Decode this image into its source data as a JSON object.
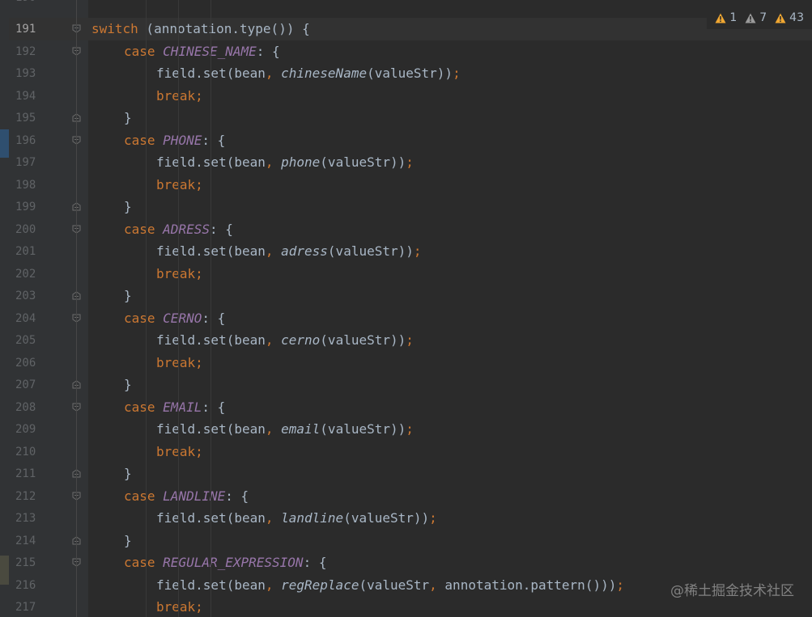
{
  "editor": {
    "partial_top_line": "190",
    "current_line": "191",
    "colors": {
      "background": "#2b2b2b",
      "gutter": "#313335",
      "keyword": "#cc7832",
      "constant": "#9876aa",
      "default_text": "#a9b7c6",
      "line_number": "#606366",
      "warning": "#f0a732"
    },
    "lines": [
      {
        "num": "191",
        "indent": 3,
        "fold": "start",
        "tokens": [
          {
            "t": "switch",
            "c": "kw"
          },
          {
            "t": " (annotation.type()) {",
            "c": "plain"
          }
        ]
      },
      {
        "num": "192",
        "indent": 4,
        "fold": "start",
        "tokens": [
          {
            "t": "case ",
            "c": "kw"
          },
          {
            "t": "CHINESE_NAME",
            "c": "const"
          },
          {
            "t": ": {",
            "c": "plain"
          }
        ]
      },
      {
        "num": "193",
        "indent": 5,
        "fold": "",
        "tokens": [
          {
            "t": "field.set(bean",
            "c": "plain"
          },
          {
            "t": ", ",
            "c": "punct"
          },
          {
            "t": "chineseName",
            "c": "method"
          },
          {
            "t": "(valueStr))",
            "c": "plain"
          },
          {
            "t": ";",
            "c": "punct"
          }
        ]
      },
      {
        "num": "194",
        "indent": 5,
        "fold": "",
        "tokens": [
          {
            "t": "break;",
            "c": "kw"
          }
        ]
      },
      {
        "num": "195",
        "indent": 4,
        "fold": "end",
        "tokens": [
          {
            "t": "}",
            "c": "plain"
          }
        ]
      },
      {
        "num": "196",
        "indent": 4,
        "fold": "start",
        "tokens": [
          {
            "t": "case ",
            "c": "kw"
          },
          {
            "t": "PHONE",
            "c": "const"
          },
          {
            "t": ": {",
            "c": "plain"
          }
        ]
      },
      {
        "num": "197",
        "indent": 5,
        "fold": "",
        "tokens": [
          {
            "t": "field.set(bean",
            "c": "plain"
          },
          {
            "t": ", ",
            "c": "punct"
          },
          {
            "t": "phone",
            "c": "method"
          },
          {
            "t": "(valueStr))",
            "c": "plain"
          },
          {
            "t": ";",
            "c": "punct"
          }
        ]
      },
      {
        "num": "198",
        "indent": 5,
        "fold": "",
        "tokens": [
          {
            "t": "break;",
            "c": "kw"
          }
        ]
      },
      {
        "num": "199",
        "indent": 4,
        "fold": "end",
        "tokens": [
          {
            "t": "}",
            "c": "plain"
          }
        ]
      },
      {
        "num": "200",
        "indent": 4,
        "fold": "start",
        "tokens": [
          {
            "t": "case ",
            "c": "kw"
          },
          {
            "t": "ADRESS",
            "c": "const"
          },
          {
            "t": ": {",
            "c": "plain"
          }
        ]
      },
      {
        "num": "201",
        "indent": 5,
        "fold": "",
        "tokens": [
          {
            "t": "field.set(bean",
            "c": "plain"
          },
          {
            "t": ", ",
            "c": "punct"
          },
          {
            "t": "adress",
            "c": "method"
          },
          {
            "t": "(valueStr))",
            "c": "plain"
          },
          {
            "t": ";",
            "c": "punct"
          }
        ]
      },
      {
        "num": "202",
        "indent": 5,
        "fold": "",
        "tokens": [
          {
            "t": "break;",
            "c": "kw"
          }
        ]
      },
      {
        "num": "203",
        "indent": 4,
        "fold": "end",
        "tokens": [
          {
            "t": "}",
            "c": "plain"
          }
        ]
      },
      {
        "num": "204",
        "indent": 4,
        "fold": "start",
        "tokens": [
          {
            "t": "case ",
            "c": "kw"
          },
          {
            "t": "CERNO",
            "c": "const"
          },
          {
            "t": ": {",
            "c": "plain"
          }
        ]
      },
      {
        "num": "205",
        "indent": 5,
        "fold": "",
        "tokens": [
          {
            "t": "field.set(bean",
            "c": "plain"
          },
          {
            "t": ", ",
            "c": "punct"
          },
          {
            "t": "cerno",
            "c": "method"
          },
          {
            "t": "(valueStr))",
            "c": "plain"
          },
          {
            "t": ";",
            "c": "punct"
          }
        ]
      },
      {
        "num": "206",
        "indent": 5,
        "fold": "",
        "tokens": [
          {
            "t": "break;",
            "c": "kw"
          }
        ]
      },
      {
        "num": "207",
        "indent": 4,
        "fold": "end",
        "tokens": [
          {
            "t": "}",
            "c": "plain"
          }
        ]
      },
      {
        "num": "208",
        "indent": 4,
        "fold": "start",
        "tokens": [
          {
            "t": "case ",
            "c": "kw"
          },
          {
            "t": "EMAIL",
            "c": "const"
          },
          {
            "t": ": {",
            "c": "plain"
          }
        ]
      },
      {
        "num": "209",
        "indent": 5,
        "fold": "",
        "tokens": [
          {
            "t": "field.set(bean",
            "c": "plain"
          },
          {
            "t": ", ",
            "c": "punct"
          },
          {
            "t": "email",
            "c": "method"
          },
          {
            "t": "(valueStr))",
            "c": "plain"
          },
          {
            "t": ";",
            "c": "punct"
          }
        ]
      },
      {
        "num": "210",
        "indent": 5,
        "fold": "",
        "tokens": [
          {
            "t": "break;",
            "c": "kw"
          }
        ]
      },
      {
        "num": "211",
        "indent": 4,
        "fold": "end",
        "tokens": [
          {
            "t": "}",
            "c": "plain"
          }
        ]
      },
      {
        "num": "212",
        "indent": 4,
        "fold": "start",
        "tokens": [
          {
            "t": "case ",
            "c": "kw"
          },
          {
            "t": "LANDLINE",
            "c": "const"
          },
          {
            "t": ": {",
            "c": "plain"
          }
        ]
      },
      {
        "num": "213",
        "indent": 5,
        "fold": "",
        "tokens": [
          {
            "t": "field.set(bean",
            "c": "plain"
          },
          {
            "t": ", ",
            "c": "punct"
          },
          {
            "t": "landline",
            "c": "method"
          },
          {
            "t": "(valueStr))",
            "c": "plain"
          },
          {
            "t": ";",
            "c": "punct"
          }
        ]
      },
      {
        "num": "214",
        "indent": 4,
        "fold": "end",
        "tokens": [
          {
            "t": "}",
            "c": "plain"
          }
        ]
      },
      {
        "num": "215",
        "indent": 4,
        "fold": "start",
        "tokens": [
          {
            "t": "case ",
            "c": "kw"
          },
          {
            "t": "REGULAR_EXPRESSION",
            "c": "const"
          },
          {
            "t": ": {",
            "c": "plain"
          }
        ]
      },
      {
        "num": "216",
        "indent": 5,
        "fold": "",
        "tokens": [
          {
            "t": "field.set(bean",
            "c": "plain"
          },
          {
            "t": ", ",
            "c": "punct"
          },
          {
            "t": "regReplace",
            "c": "method"
          },
          {
            "t": "(valueStr",
            "c": "plain"
          },
          {
            "t": ", ",
            "c": "punct"
          },
          {
            "t": "annotation.pattern()))",
            "c": "plain"
          },
          {
            "t": ";",
            "c": "punct"
          }
        ]
      },
      {
        "num": "217",
        "indent": 5,
        "fold": "",
        "tokens": [
          {
            "t": "break;",
            "c": "kw"
          }
        ]
      }
    ]
  },
  "inspections": [
    {
      "icon": "warning-icon",
      "count": "1",
      "color": "#f0a732"
    },
    {
      "icon": "weak-warning-icon",
      "count": "7",
      "color": "#9a9a9a"
    },
    {
      "icon": "typo-warning-icon",
      "count": "43",
      "color": "#f0a732"
    }
  ],
  "watermark": "@稀土掘金技术社区"
}
